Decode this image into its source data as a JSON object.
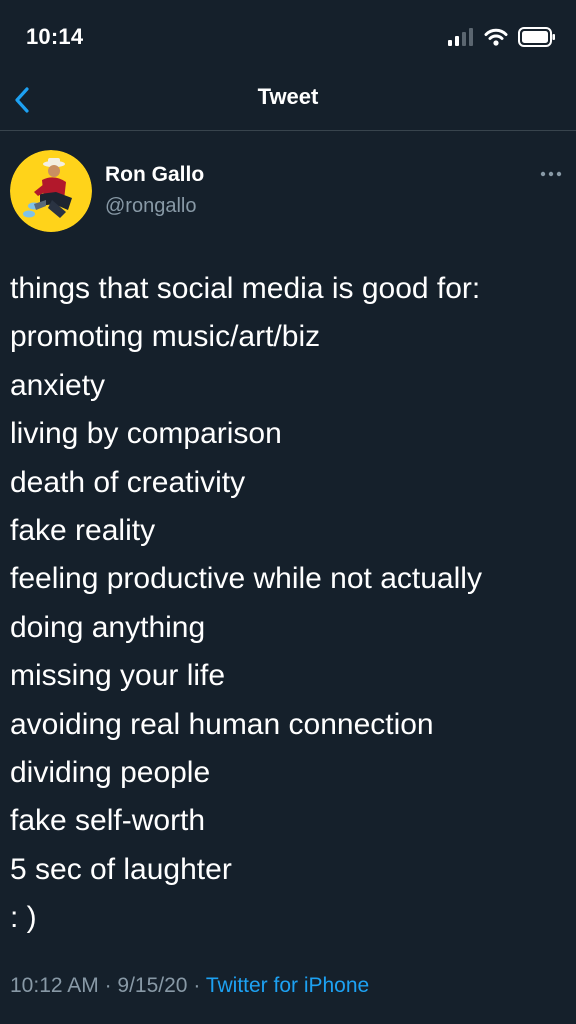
{
  "status_bar": {
    "time": "10:14"
  },
  "nav": {
    "title": "Tweet",
    "back_icon": "chevron-left-icon"
  },
  "author": {
    "name": "Ron Gallo",
    "handle": "@rongallo"
  },
  "tweet": {
    "lines": [
      "things that social media is good for:",
      "promoting music/art/biz",
      "anxiety",
      "living by comparison",
      "death of creativity",
      "fake reality",
      "feeling productive while not actually",
      "doing anything",
      "missing your life",
      "avoiding real human connection",
      "dividing people",
      "fake self-worth",
      "5 sec of laughter",
      ": )"
    ],
    "time": "10:12 AM",
    "separator_1": "·",
    "date": "9/15/20",
    "separator_2": "·",
    "source": "Twitter for iPhone"
  },
  "colors": {
    "background": "#15202b",
    "accent": "#1da1f2",
    "secondary_text": "#8899a6",
    "avatar_background": "#ffd31a"
  }
}
